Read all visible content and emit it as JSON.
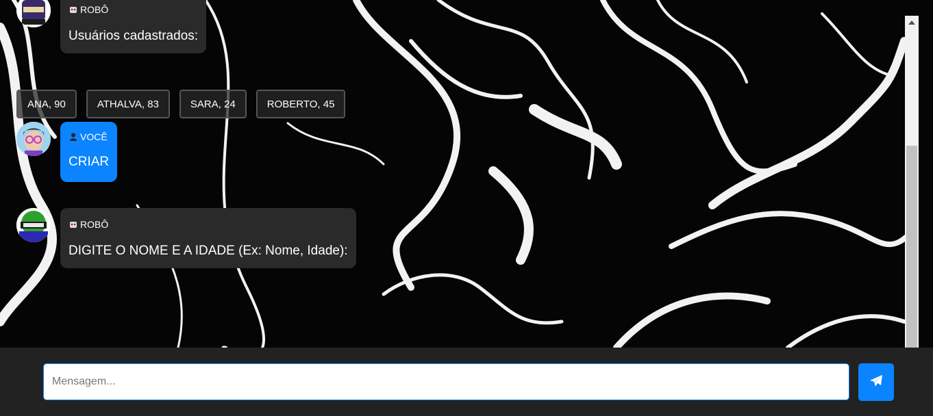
{
  "messages": [
    {
      "sender": "ROBÔ",
      "text": "Usuários cadastrados:",
      "role": "bot"
    },
    {
      "sender": "VOCÊ",
      "text": "CRIAR",
      "role": "user"
    },
    {
      "sender": "ROBÔ",
      "text": "DIGITE O NOME E A IDADE (Ex: Nome, Idade):",
      "role": "bot"
    }
  ],
  "users": [
    "ANA, 90",
    "ATHALVA, 83",
    "SARA, 24",
    "ROBERTO, 45"
  ],
  "composer": {
    "placeholder": "Mensagem...",
    "send_icon": "paper-plane-icon"
  },
  "colors": {
    "user_bubble": "#0a84ff",
    "bot_bubble": "#2a2a2a",
    "accent": "#0a84ff"
  }
}
